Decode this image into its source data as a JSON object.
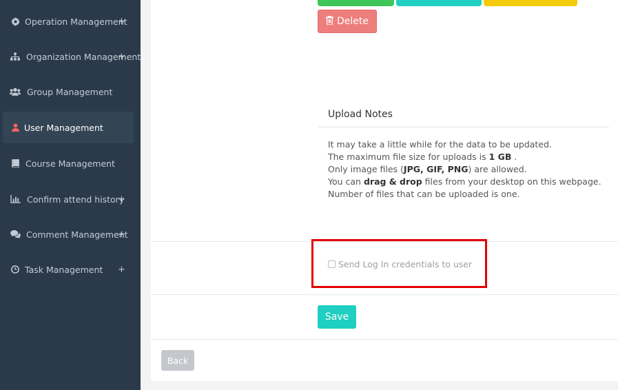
{
  "sidebar": {
    "items": [
      {
        "label": "Operation Management",
        "icon": "gear-icon",
        "expandable": true
      },
      {
        "label": "Organization Management",
        "icon": "sitemap-icon",
        "expandable": true
      },
      {
        "label": "Group Management",
        "icon": "users-icon",
        "expandable": false
      },
      {
        "label": "User Management",
        "icon": "user-icon",
        "expandable": false,
        "active": true
      },
      {
        "label": "Course Management",
        "icon": "book-icon",
        "expandable": false
      },
      {
        "label": "Confirm attend history",
        "icon": "bar-chart-icon",
        "expandable": true
      },
      {
        "label": "Comment Management",
        "icon": "comments-icon",
        "expandable": true
      },
      {
        "label": "Task Management",
        "icon": "clock-icon",
        "expandable": true
      }
    ],
    "plus_glyph": "+"
  },
  "buttons": {
    "delete": "Delete",
    "save": "Save",
    "back": "Back"
  },
  "upload_notes": {
    "title": "Upload Notes",
    "line1": "It may take a little while for the data to be updated.",
    "line2_pre": "The maximum file size for uploads is ",
    "line2_bold": "1 GB",
    "line2_post": " .",
    "line3_pre": "Only image files (",
    "line3_bold": "JPG, GIF, PNG",
    "line3_post": ") are allowed.",
    "line4_pre": "You can ",
    "line4_bold": "drag & drop",
    "line4_post": " files from your desktop on this webpage.",
    "line5": "Number of files that can be uploaded is one."
  },
  "credentials": {
    "label": "Send Log In credentials to user",
    "checked": false
  },
  "colors": {
    "sidebar_bg": "#2b3a4a",
    "accent_teal": "#1fcfbf",
    "delete_red": "#ee7e7c",
    "highlight_red": "#e50000",
    "green": "#3ec65a",
    "yellow": "#f5cc0a",
    "active_icon": "#f0645c"
  }
}
